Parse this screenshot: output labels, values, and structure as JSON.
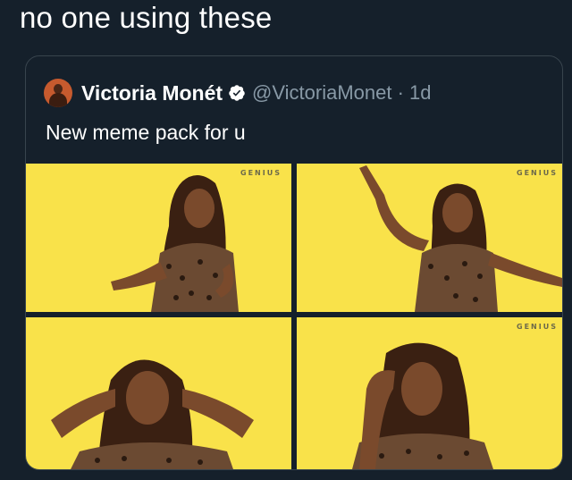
{
  "caption": "no one using these",
  "tweet": {
    "author_name": "Victoria Monét",
    "handle_time": "@VictoriaMonet · 1d",
    "text": "New meme pack for u"
  },
  "images": [
    {
      "watermark": "GENIUS"
    },
    {
      "watermark": "GENIUS"
    },
    {
      "watermark": ""
    },
    {
      "watermark": "GENIUS"
    }
  ],
  "colors": {
    "background": "#15202b",
    "border": "#38444d",
    "muted_text": "#8899a6",
    "verified_blue": "#1d9bf0",
    "photo_yellow": "#f9e24a"
  },
  "icons": {
    "verified": "verified-badge-icon",
    "avatar": "profile-avatar"
  }
}
